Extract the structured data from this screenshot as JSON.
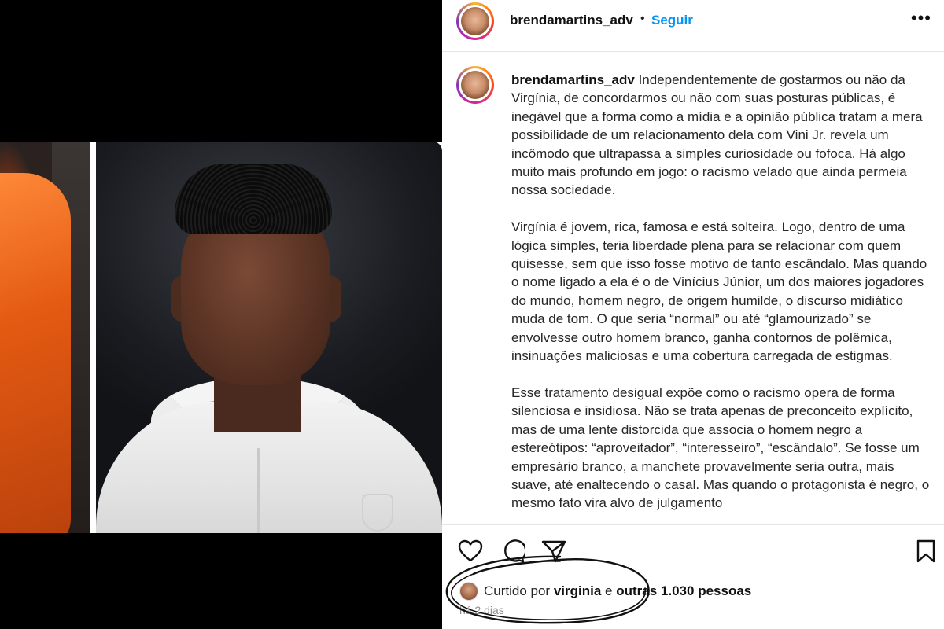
{
  "post": {
    "username": "brendamartins_adv",
    "dot": "•",
    "follow_label": "Seguir",
    "more_label": "•••",
    "caption_p1": "Independentemente de gostarmos ou não da Virgínia, de concordarmos ou não com suas posturas públicas, é inegável que a forma como a mídia e a opinião pública tratam a mera possibilidade de um relacionamento dela com Vini Jr. revela um incômodo que ultrapassa a simples curiosidade ou fofoca. Há algo muito mais profundo em jogo: o racismo velado que ainda permeia nossa sociedade.",
    "caption_p2": "Virgínia é jovem, rica, famosa e está solteira. Logo, dentro de uma lógica simples, teria liberdade plena para se relacionar com quem quisesse, sem que isso fosse motivo de tanto escândalo. Mas quando o nome ligado a ela é o de Vinícius Júnior, um dos maiores jogadores do mundo, homem negro, de origem humilde, o discurso midiático muda de tom. O que seria “normal” ou até “glamourizado” se envolvesse outro homem branco, ganha contornos de polêmica, insinuações maliciosas e uma cobertura carregada de estigmas.",
    "caption_p3": "Esse tratamento desigual expõe como o racismo opera de forma silenciosa e insidiosa. Não se trata apenas de preconceito explícito, mas de uma lente distorcida que associa o homem negro a estereótipos: “aproveitador”, “interesseiro”, “escândalo”. Se fosse um empresário branco, a manchete provavelmente seria outra, mais suave, até enaltecendo o casal. Mas quando o protagonista é negro, o mesmo fato vira alvo de julgamento"
  },
  "likes": {
    "prefix": "Curtido por",
    "user": "virginia",
    "conjunction": "e",
    "others": "outras 1.030 pessoas"
  },
  "timestamp": "há 2 dias",
  "icons": [
    "heart-icon",
    "comment-icon",
    "share-icon",
    "bookmark-icon"
  ],
  "colors": {
    "follow": "#0095f6",
    "hair": "#e8490b"
  }
}
